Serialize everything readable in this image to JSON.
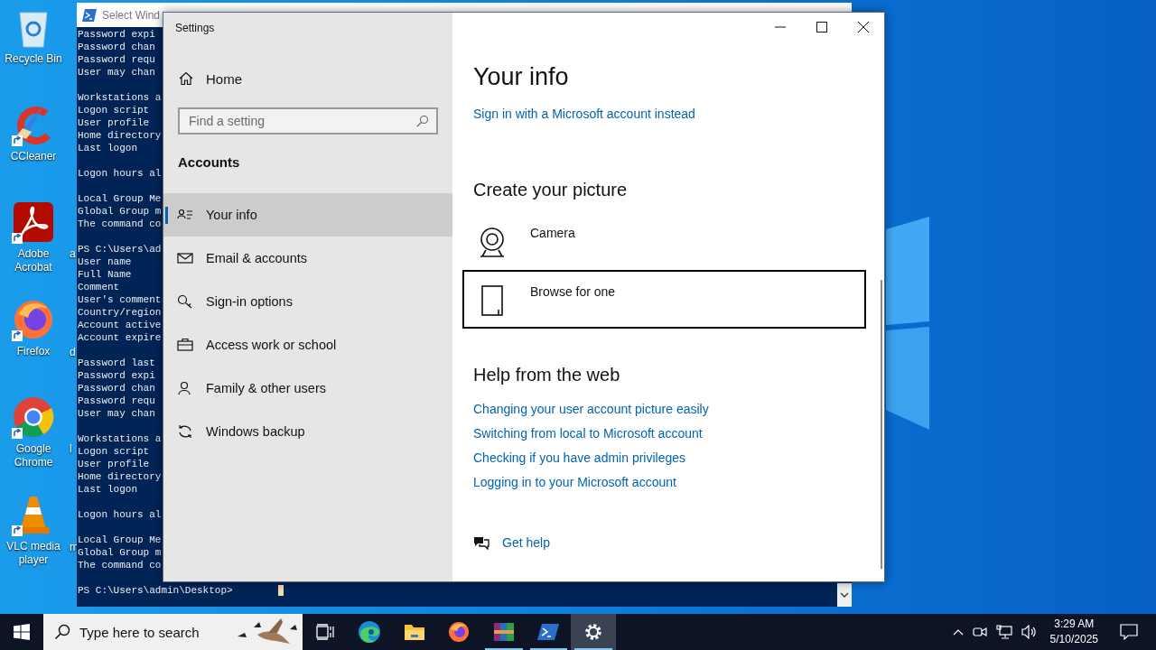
{
  "desktop": {
    "icons": [
      {
        "label": "Recycle Bin",
        "kind": "recycle",
        "shortcut": false
      },
      {
        "label": "CCleaner",
        "kind": "ccleaner",
        "shortcut": true
      },
      {
        "label": "Adobe Acrobat",
        "kind": "acrobat",
        "shortcut": true
      },
      {
        "label": "Firefox",
        "kind": "firefox",
        "shortcut": true
      },
      {
        "label": "Google Chrome",
        "kind": "chrome",
        "shortcut": true
      },
      {
        "label": "VLC media player",
        "kind": "vlc",
        "shortcut": true
      }
    ],
    "partial_labels": [
      "a",
      "d",
      "l",
      "m"
    ]
  },
  "terminal": {
    "title": "Select Wind",
    "blocks": [
      [
        "Password expi",
        "Password chan",
        "Password requ",
        "User may chan"
      ],
      [
        "Workstations a",
        "Logon script",
        "User profile",
        "Home directory",
        "Last logon"
      ],
      [
        "Logon hours al"
      ],
      [
        "Local Group Me",
        "Global Group m",
        "The command co"
      ],
      [
        "PS C:\\Users\\ad",
        "User name",
        "Full Name",
        "Comment",
        "User's comment",
        "Country/region",
        "Account active",
        "Account expire"
      ],
      [
        "Password last",
        "Password expi",
        "Password chan",
        "Password requ",
        "User may chan"
      ],
      [
        "Workstations a",
        "Logon script",
        "User profile",
        "Home directory",
        "Last logon"
      ],
      [
        "Logon hours al"
      ],
      [
        "Local Group Me",
        "Global Group m",
        "The command co"
      ]
    ],
    "prompt": "PS C:\\Users\\admin\\Desktop>"
  },
  "settings": {
    "title": "Settings",
    "home": "Home",
    "search": {
      "placeholder": "Find a setting"
    },
    "section": "Accounts",
    "nav": [
      {
        "label": "Your info",
        "selected": true
      },
      {
        "label": "Email & accounts",
        "selected": false
      },
      {
        "label": "Sign-in options",
        "selected": false
      },
      {
        "label": "Access work or school",
        "selected": false
      },
      {
        "label": "Family & other users",
        "selected": false
      },
      {
        "label": "Windows backup",
        "selected": false
      }
    ],
    "page_title": "Your info",
    "signin_link": "Sign in with a Microsoft account instead",
    "picture_heading": "Create your picture",
    "picture_options": [
      {
        "label": "Camera",
        "selected": false
      },
      {
        "label": "Browse for one",
        "selected": true
      }
    ],
    "help_heading": "Help from the web",
    "help_links": [
      "Changing your user account picture easily",
      "Switching from local to Microsoft account",
      "Checking if you have admin privileges",
      "Logging in to your Microsoft account"
    ],
    "get_help": "Get help"
  },
  "taskbar": {
    "search_placeholder": "Type here to search",
    "apps": [
      {
        "kind": "taskview",
        "running": false,
        "selected": false
      },
      {
        "kind": "edge",
        "running": false,
        "selected": false
      },
      {
        "kind": "explorer",
        "running": false,
        "selected": false
      },
      {
        "kind": "firefox",
        "running": false,
        "selected": false
      },
      {
        "kind": "winrar",
        "running": true,
        "selected": false
      },
      {
        "kind": "powershell",
        "running": true,
        "selected": false
      },
      {
        "kind": "settings",
        "running": true,
        "selected": true
      }
    ],
    "clock": {
      "time": "3:29 AM",
      "date": "5/10/2025"
    }
  }
}
